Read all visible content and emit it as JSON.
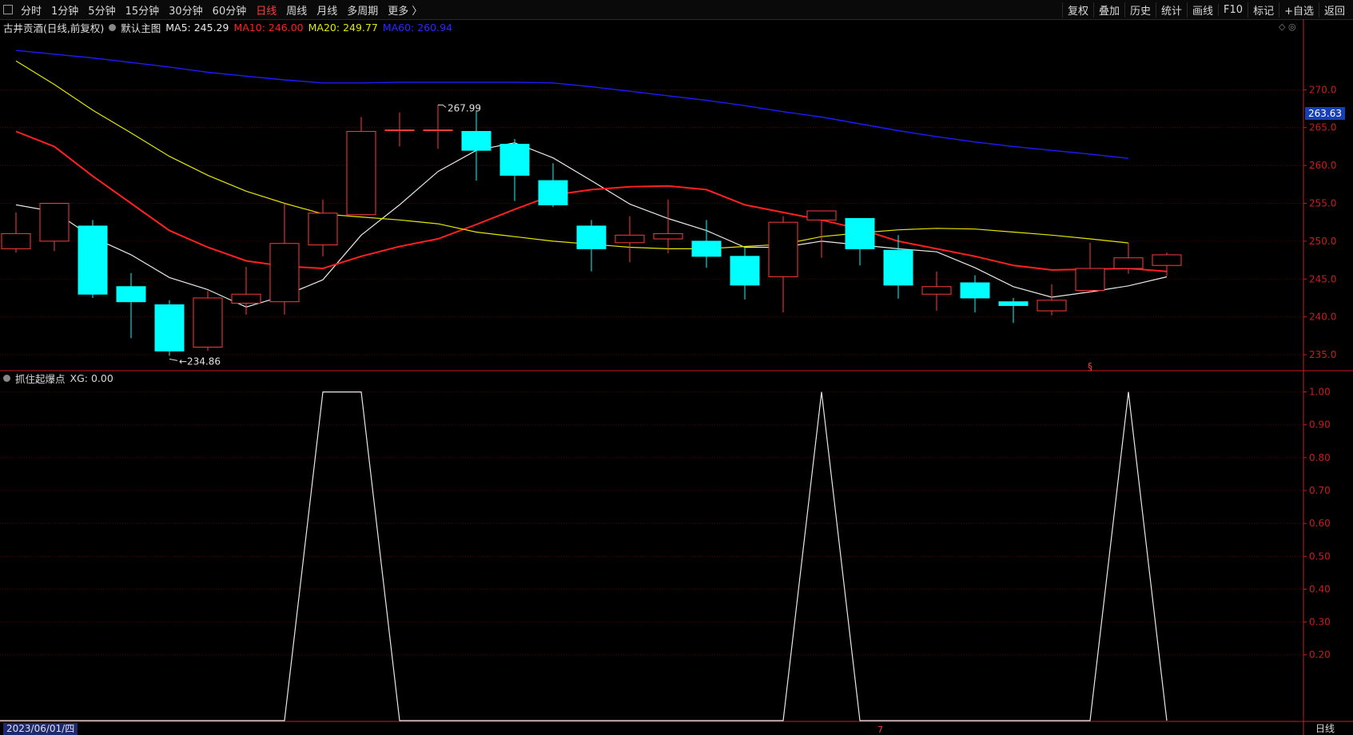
{
  "toolbar": {
    "timeframes": [
      "分时",
      "1分钟",
      "5分钟",
      "15分钟",
      "30分钟",
      "60分钟",
      "日线",
      "周线",
      "月线",
      "多周期",
      "更多 〉"
    ],
    "active_index": 6,
    "right_buttons": [
      "复权",
      "叠加",
      "历史",
      "统计",
      "画线",
      "F10",
      "标记",
      "+自选",
      "返回"
    ]
  },
  "legend": {
    "stock": "古井贡酒(日线,前复权)",
    "template": "默认主图",
    "ma5": "MA5: 245.29",
    "ma10": "MA10: 246.00",
    "ma20": "MA20: 249.77",
    "ma60": "MA60: 260.94"
  },
  "indicator_legend": {
    "name": "抓住起爆点",
    "value": "XG: 0.00"
  },
  "last_price_tag": "263.63",
  "date_tag": "2023/06/01/四",
  "period_tag": "日线",
  "corner_icons": "◇ ◎",
  "colors": {
    "up": "#ff3b3b",
    "down": "#00ffff",
    "ma5": "#e8e8e8",
    "ma10": "#ff2020",
    "ma20": "#e6e600",
    "ma60": "#1c1cff",
    "grid": "#5a0000",
    "axis": "#c81e1e"
  },
  "chart_data": [
    {
      "type": "candlestick",
      "title": "古井贡酒(日线,前复权)",
      "ylim": [
        233,
        277
      ],
      "y_ticks": [
        235.0,
        240.0,
        245.0,
        250.0,
        255.0,
        260.0,
        265.0,
        270.0
      ],
      "y_tick_labels": [
        "235.0",
        "240.0",
        "245.0",
        "250.0",
        "255.0",
        "260.0",
        "265.0",
        "270.0"
      ],
      "candles": [
        {
          "o": 249.0,
          "c": 251.0,
          "h": 253.8,
          "l": 248.5
        },
        {
          "o": 250.0,
          "c": 255.0,
          "h": 255.0,
          "l": 248.7
        },
        {
          "o": 252.0,
          "c": 243.0,
          "h": 252.8,
          "l": 242.5
        },
        {
          "o": 244.0,
          "c": 242.0,
          "h": 245.8,
          "l": 237.2
        },
        {
          "o": 241.6,
          "c": 235.5,
          "h": 242.2,
          "l": 234.86
        },
        {
          "o": 236.0,
          "c": 242.5,
          "h": 243.4,
          "l": 235.5
        },
        {
          "o": 241.8,
          "c": 243.0,
          "h": 246.6,
          "l": 240.3
        },
        {
          "o": 242.0,
          "c": 249.7,
          "h": 255.0,
          "l": 240.3
        },
        {
          "o": 249.5,
          "c": 253.7,
          "h": 255.5,
          "l": 248.0
        },
        {
          "o": 253.5,
          "c": 264.5,
          "h": 266.4,
          "l": 253.5
        },
        {
          "o": 264.7,
          "c": 264.7,
          "h": 267.0,
          "l": 262.5
        },
        {
          "o": 264.7,
          "c": 264.7,
          "h": 267.99,
          "l": 262.2
        },
        {
          "o": 264.5,
          "c": 262.0,
          "h": 267.2,
          "l": 258.0
        },
        {
          "o": 262.8,
          "c": 258.7,
          "h": 263.5,
          "l": 255.3
        },
        {
          "o": 258.0,
          "c": 254.8,
          "h": 260.3,
          "l": 254.5
        },
        {
          "o": 252.0,
          "c": 249.0,
          "h": 252.8,
          "l": 246.0
        },
        {
          "o": 249.8,
          "c": 250.8,
          "h": 253.3,
          "l": 247.2
        },
        {
          "o": 250.3,
          "c": 251.0,
          "h": 255.5,
          "l": 248.4
        },
        {
          "o": 250.0,
          "c": 248.0,
          "h": 252.8,
          "l": 246.5
        },
        {
          "o": 248.0,
          "c": 244.2,
          "h": 249.2,
          "l": 242.3
        },
        {
          "o": 245.3,
          "c": 252.5,
          "h": 253.3,
          "l": 240.6
        },
        {
          "o": 252.8,
          "c": 254.0,
          "h": 254.0,
          "l": 247.8
        },
        {
          "o": 253.0,
          "c": 249.0,
          "h": 253.0,
          "l": 246.8
        },
        {
          "o": 248.8,
          "c": 244.2,
          "h": 250.8,
          "l": 242.4
        },
        {
          "o": 243.0,
          "c": 244.0,
          "h": 246.0,
          "l": 240.8
        },
        {
          "o": 244.5,
          "c": 242.5,
          "h": 245.5,
          "l": 240.6
        },
        {
          "o": 242.0,
          "c": 241.5,
          "h": 242.5,
          "l": 239.2
        },
        {
          "o": 240.8,
          "c": 242.2,
          "h": 244.3,
          "l": 240.2
        },
        {
          "o": 243.5,
          "c": 246.4,
          "h": 249.8,
          "l": 243.2
        },
        {
          "o": 246.4,
          "c": 247.8,
          "h": 249.8,
          "l": 245.7
        },
        {
          "o": 246.8,
          "c": 248.2,
          "h": 248.5,
          "l": 245.4
        }
      ],
      "series": [
        {
          "name": "MA5",
          "values": [
            254.8,
            253.9,
            250.5,
            248.2,
            245.2,
            243.6,
            241.3,
            242.8,
            244.9,
            250.8,
            254.8,
            259.2,
            262.0,
            263.0,
            261.0,
            258.0,
            254.9,
            253.0,
            251.4,
            249.2,
            249.2,
            250.0,
            249.5,
            249.0,
            248.6,
            246.5,
            244.0,
            242.6,
            243.3,
            244.1,
            245.29
          ]
        },
        {
          "name": "MA10",
          "values": [
            264.5,
            262.5,
            258.6,
            255.0,
            251.4,
            249.2,
            247.4,
            246.7,
            246.4,
            248.0,
            249.3,
            250.3,
            252.2,
            254.2,
            256.1,
            256.8,
            257.2,
            257.3,
            256.8,
            254.8,
            253.8,
            252.8,
            251.6,
            250.0,
            249.0,
            248.0,
            246.8,
            246.2,
            246.3,
            246.4,
            246.0
          ]
        },
        {
          "name": "MA20",
          "values": [
            273.8,
            270.7,
            267.3,
            264.3,
            261.2,
            258.7,
            256.6,
            255.0,
            253.6,
            253.2,
            252.8,
            252.3,
            251.2,
            250.6,
            250.0,
            249.6,
            249.2,
            249.0,
            249.0,
            249.3,
            249.6,
            250.6,
            251.1,
            251.5,
            251.7,
            251.6,
            251.2,
            250.8,
            250.3,
            249.77
          ]
        },
        {
          "name": "MA60",
          "values": [
            275.2,
            274.7,
            274.2,
            273.6,
            273.0,
            272.3,
            271.8,
            271.3,
            270.9,
            270.9,
            271.0,
            271.0,
            271.0,
            271.0,
            270.9,
            270.4,
            269.8,
            269.2,
            268.6,
            267.9,
            267.1,
            266.4,
            265.5,
            264.6,
            263.8,
            263.1,
            262.5,
            262.0,
            261.5,
            260.94
          ]
        }
      ],
      "annotations": [
        {
          "text": "267.99",
          "candle": 11,
          "value": 267.99
        },
        {
          "text": "234.86",
          "candle": 4,
          "value": 234.86
        },
        {
          "text": "§",
          "candle": 28,
          "value": 233.4
        }
      ]
    },
    {
      "type": "line",
      "title": "抓住起爆点",
      "ylim": [
        0,
        1.05
      ],
      "y_ticks": [
        0.2,
        0.3,
        0.4,
        0.5,
        0.6,
        0.7,
        0.8,
        0.9,
        1.0
      ],
      "y_tick_labels": [
        "0.20",
        "0.30",
        "0.40",
        "0.50",
        "0.60",
        "0.70",
        "0.80",
        "0.90",
        "1.00"
      ],
      "series": [
        {
          "name": "XG",
          "values": [
            0,
            0,
            0,
            0,
            0,
            0,
            0,
            0,
            1,
            1,
            0,
            0,
            0,
            0,
            0,
            0,
            0,
            0,
            0,
            0,
            0,
            1,
            0,
            0,
            0,
            0,
            0,
            0,
            0,
            1,
            0
          ]
        }
      ]
    }
  ]
}
